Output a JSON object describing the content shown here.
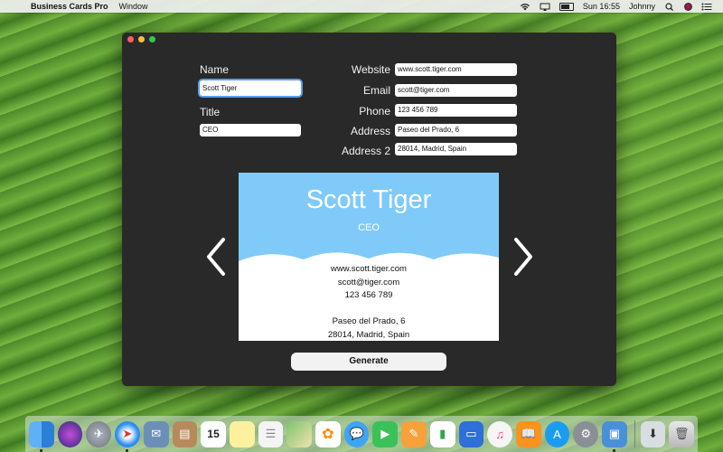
{
  "menubar": {
    "apple_glyph": "",
    "app_name": "Business Cards Pro",
    "menu": "Window",
    "clock": "Sun 16:55",
    "user": "Johnny"
  },
  "form": {
    "name_label": "Name",
    "name_value": "Scott Tiger",
    "title_label": "Title",
    "title_value": "CEO",
    "website_label": "Website",
    "website_value": "www.scott.tiger.com",
    "email_label": "Email",
    "email_value": "scott@tiger.com",
    "phone_label": "Phone",
    "phone_value": "123 456 789",
    "address_label": "Address",
    "address_value": "Paseo del Prado, 6",
    "address2_label": "Address 2",
    "address2_value": "28014, Madrid, Spain"
  },
  "card": {
    "name": "Scott Tiger",
    "title": "CEO",
    "website": "www.scott.tiger.com",
    "email": "scott@tiger.com",
    "phone": "123 456 789",
    "address": "Paseo del Prado, 6",
    "address2": "28014, Madrid, Spain",
    "color": "#7fcaf8"
  },
  "generate_label": "Generate",
  "dock": {
    "calendar_day": "15",
    "apps": [
      "finder",
      "siri",
      "launchpad",
      "safari",
      "mail",
      "contacts",
      "calendar",
      "notes",
      "reminders",
      "maps",
      "photos",
      "messages",
      "facetime",
      "pages",
      "numbers",
      "keynote",
      "itunes",
      "ibooks",
      "app-store",
      "system-preferences",
      "directory-utility",
      "trash"
    ]
  }
}
